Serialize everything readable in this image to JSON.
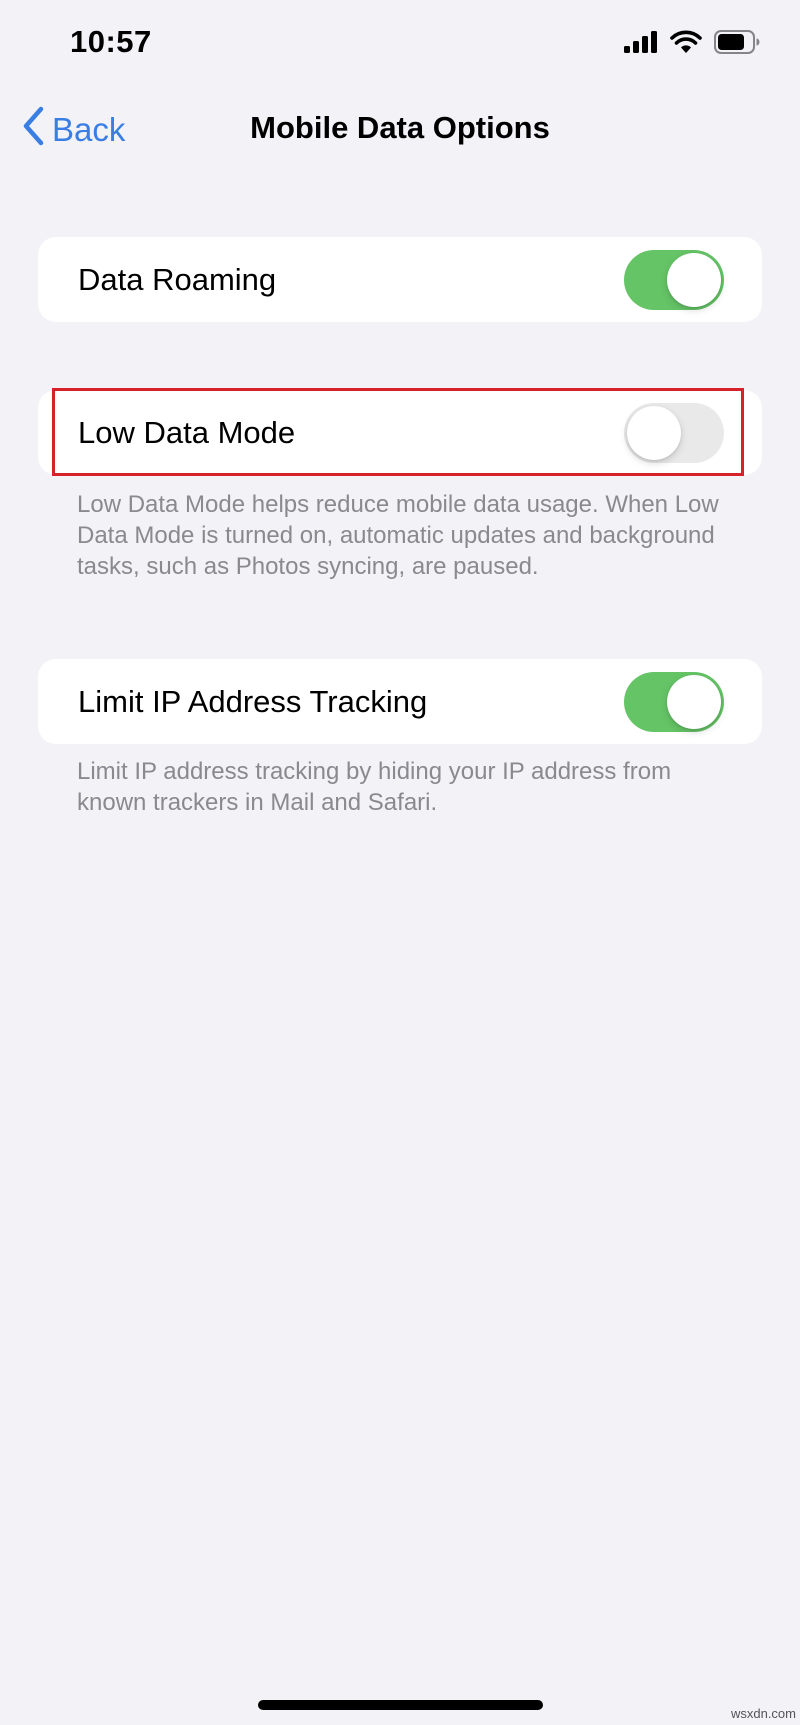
{
  "status_bar": {
    "time": "10:57",
    "icons": [
      "cellular-signal-icon",
      "wifi-icon",
      "battery-icon"
    ]
  },
  "nav": {
    "back_label": "Back",
    "title": "Mobile Data Options"
  },
  "settings": {
    "data_roaming": {
      "label": "Data Roaming",
      "enabled": true
    },
    "low_data_mode": {
      "label": "Low Data Mode",
      "enabled": false,
      "description": "Low Data Mode helps reduce mobile data usage. When Low Data Mode is turned on, automatic updates and background tasks, such as Photos syncing, are paused."
    },
    "limit_ip_tracking": {
      "label": "Limit IP Address Tracking",
      "enabled": true,
      "description": "Limit IP address tracking by hiding your IP address from known trackers in Mail and Safari."
    }
  },
  "colors": {
    "accent_blue": "#3a7ee4",
    "toggle_on": "#65c466",
    "toggle_off": "#e9e9ea",
    "highlight_red": "#d8222b",
    "background": "#f2f2f7"
  },
  "watermark": "wsxdn.com"
}
